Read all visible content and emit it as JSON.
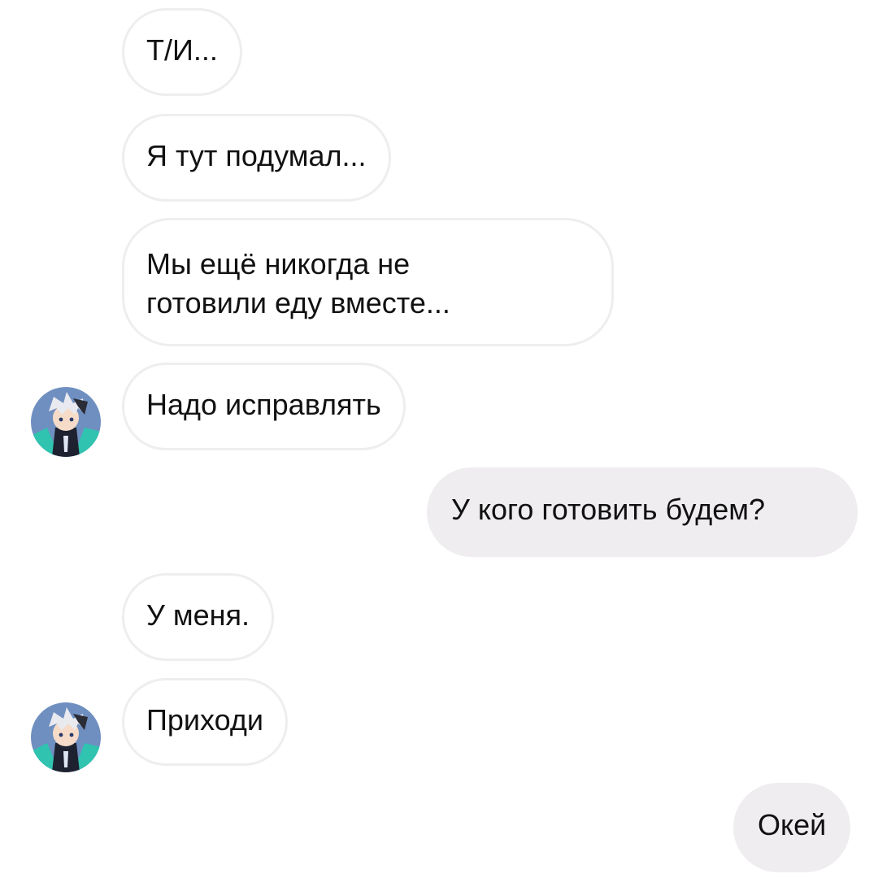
{
  "messages": [
    {
      "text": "Т/И...",
      "side": "incoming"
    },
    {
      "text": "Я тут подумал...",
      "side": "incoming"
    },
    {
      "lines": [
        "Мы ещё никогда не",
        "готовили еду вместе..."
      ],
      "side": "incoming"
    },
    {
      "text": "Надо исправлять",
      "side": "incoming"
    },
    {
      "text": "У кого готовить будем?",
      "side": "outgoing"
    },
    {
      "text": "У меня.",
      "side": "incoming"
    },
    {
      "text": "Приходи",
      "side": "incoming"
    },
    {
      "text": "Окей",
      "side": "outgoing"
    }
  ],
  "colors": {
    "background": "#ffffff",
    "incoming_border": "#eeeeee",
    "outgoing_bubble": "#efedf0",
    "text": "#111111"
  },
  "avatar_icon": "anime-character-avatar"
}
